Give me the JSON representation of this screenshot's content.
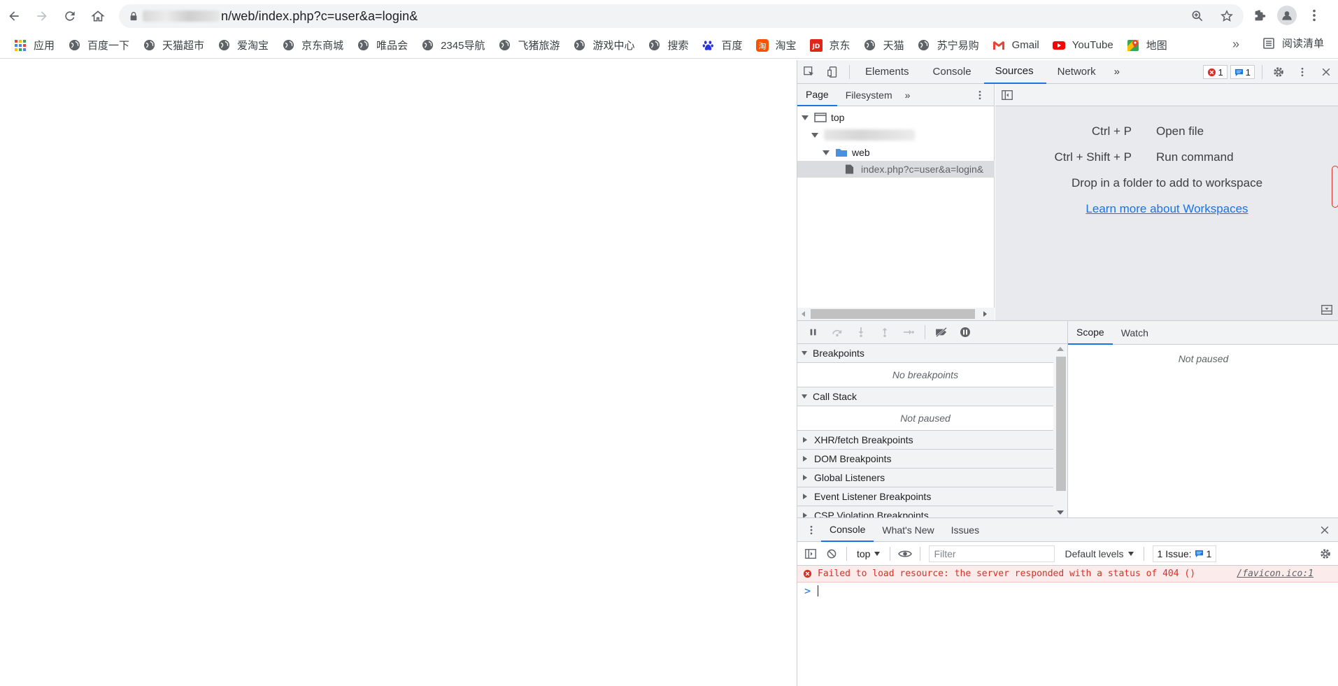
{
  "browser": {
    "url": "n/web/index.php?c=user&a=login&",
    "bookmarks": [
      {
        "label": "应用",
        "icon": "apps-grid-icon"
      },
      {
        "label": "百度一下",
        "icon": "globe-icon"
      },
      {
        "label": "天猫超市",
        "icon": "globe-icon"
      },
      {
        "label": "爱淘宝",
        "icon": "globe-icon"
      },
      {
        "label": "京东商城",
        "icon": "globe-icon"
      },
      {
        "label": "唯品会",
        "icon": "globe-icon"
      },
      {
        "label": "2345导航",
        "icon": "globe-icon"
      },
      {
        "label": "飞猪旅游",
        "icon": "globe-icon"
      },
      {
        "label": "游戏中心",
        "icon": "globe-icon"
      },
      {
        "label": "搜索",
        "icon": "globe-icon"
      },
      {
        "label": "百度",
        "icon": "baidu-paw-icon"
      },
      {
        "label": "淘宝",
        "icon": "taobao-icon"
      },
      {
        "label": "京东",
        "icon": "jd-icon"
      },
      {
        "label": "天猫",
        "icon": "globe-icon"
      },
      {
        "label": "苏宁易购",
        "icon": "globe-icon"
      },
      {
        "label": "Gmail",
        "icon": "gmail-icon"
      },
      {
        "label": "YouTube",
        "icon": "youtube-icon"
      },
      {
        "label": "地图",
        "icon": "maps-icon"
      }
    ],
    "more": "»",
    "reading_list": "阅读清单"
  },
  "devtools": {
    "tabs": [
      "Elements",
      "Console",
      "Sources",
      "Network"
    ],
    "active_tab": "Sources",
    "more_tabs": "»",
    "error_count": "1",
    "message_count": "1",
    "sources": {
      "nav_tabs": [
        "Page",
        "Filesystem"
      ],
      "nav_more": "»",
      "tree": {
        "top": "top",
        "folder": "web",
        "file": "index.php?c=user&a=login&"
      },
      "shortcuts": [
        {
          "keys": "Ctrl + P",
          "action": "Open file"
        },
        {
          "keys": "Ctrl + Shift + P",
          "action": "Run command"
        }
      ],
      "drop_text": "Drop in a folder to add to workspace",
      "workspace_link": "Learn more about Workspaces"
    },
    "debugger": {
      "sections": [
        {
          "title": "Breakpoints",
          "expanded": true,
          "body": "No breakpoints"
        },
        {
          "title": "Call Stack",
          "expanded": true,
          "body": "Not paused"
        },
        {
          "title": "XHR/fetch Breakpoints",
          "expanded": false
        },
        {
          "title": "DOM Breakpoints",
          "expanded": false
        },
        {
          "title": "Global Listeners",
          "expanded": false
        },
        {
          "title": "Event Listener Breakpoints",
          "expanded": false
        },
        {
          "title": "CSP Violation Breakpoints",
          "expanded": false
        }
      ],
      "scope_tabs": [
        "Scope",
        "Watch"
      ],
      "scope_body": "Not paused"
    },
    "drawer": {
      "tabs": [
        "Console",
        "What's New",
        "Issues"
      ],
      "context": "top",
      "filter_placeholder": "Filter",
      "levels": "Default levels",
      "issues_label": "1 Issue:",
      "issues_count": "1",
      "error_message": "Failed to load resource: the server responded with a status of 404 ()",
      "error_source": "/favicon.ico:1",
      "prompt": ">"
    },
    "colors": {
      "accent": "#1a73e8",
      "error": "#d93025"
    }
  }
}
